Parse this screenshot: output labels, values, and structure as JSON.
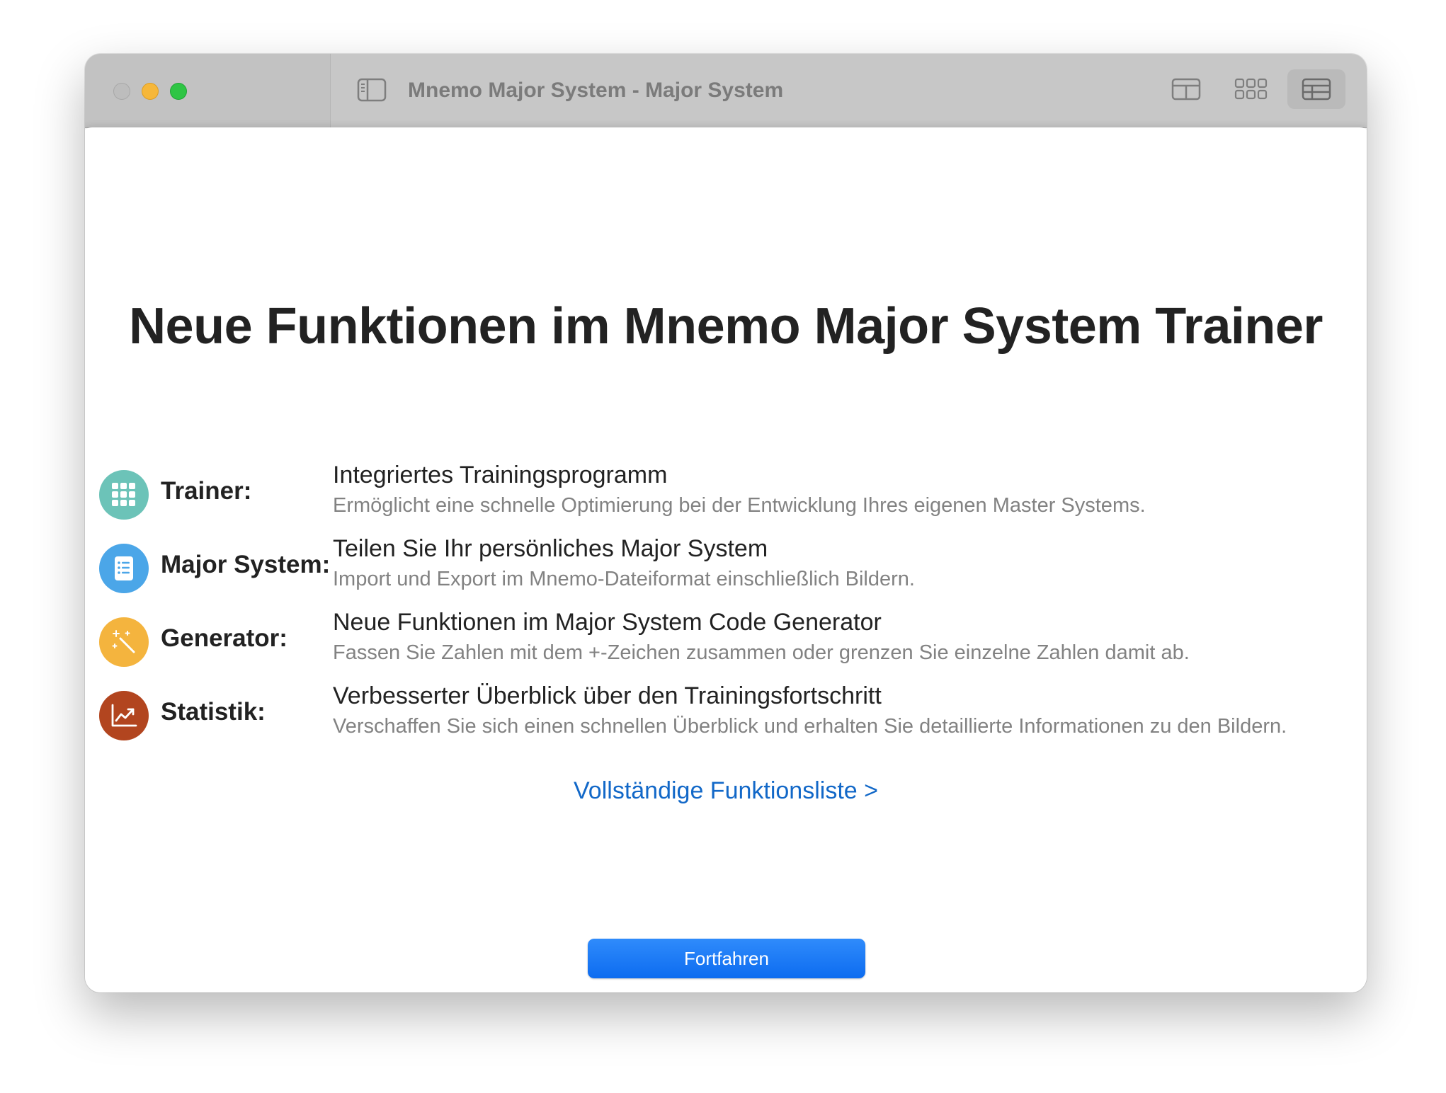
{
  "window": {
    "title": "Mnemo Major System - Major System",
    "traffic_lights": {
      "close": "#bdbdbd",
      "minimize": "#f6b73a",
      "maximize": "#2ec544"
    },
    "toolbar_icons": [
      "sidebar-toggle-icon",
      "layout-icon",
      "grid-view-icon",
      "table-view-icon"
    ]
  },
  "main": {
    "heading": "Neue Funktionen im Mnemo Major System Trainer",
    "features": [
      {
        "label": "Trainer:",
        "title": "Integriertes Trainingsprogramm",
        "description": "Ermöglicht eine schnelle Optimierung bei der Entwicklung Ihres eigenen Master Systems.",
        "icon": "keypad-icon",
        "color": "#6cc3b8"
      },
      {
        "label": "Major System:",
        "title": "Teilen Sie Ihr persönliches Major System",
        "description": "Import und Export im Mnemo-Dateiformat einschließlich Bildern.",
        "icon": "document-list-icon",
        "color": "#4ba6e8"
      },
      {
        "label": "Generator:",
        "title": "Neue Funktionen im Major System Code Generator",
        "description": "Fassen Sie Zahlen mit dem +-Zeichen zusammen oder grenzen Sie einzelne Zahlen damit ab.",
        "icon": "magic-wand-icon",
        "color": "#f4b43e"
      },
      {
        "label": "Statistik:",
        "title": "Verbesserter Überblick über den Trainingsfortschritt",
        "description": "Verschaffen Sie sich einen schnellen Überblick und erhalten Sie detaillierte Informationen zu den Bildern.",
        "icon": "chart-line-icon",
        "color": "#b2451f"
      }
    ],
    "link": "Vollständige Funktionsliste >",
    "continue_button": "Fortfahren"
  }
}
